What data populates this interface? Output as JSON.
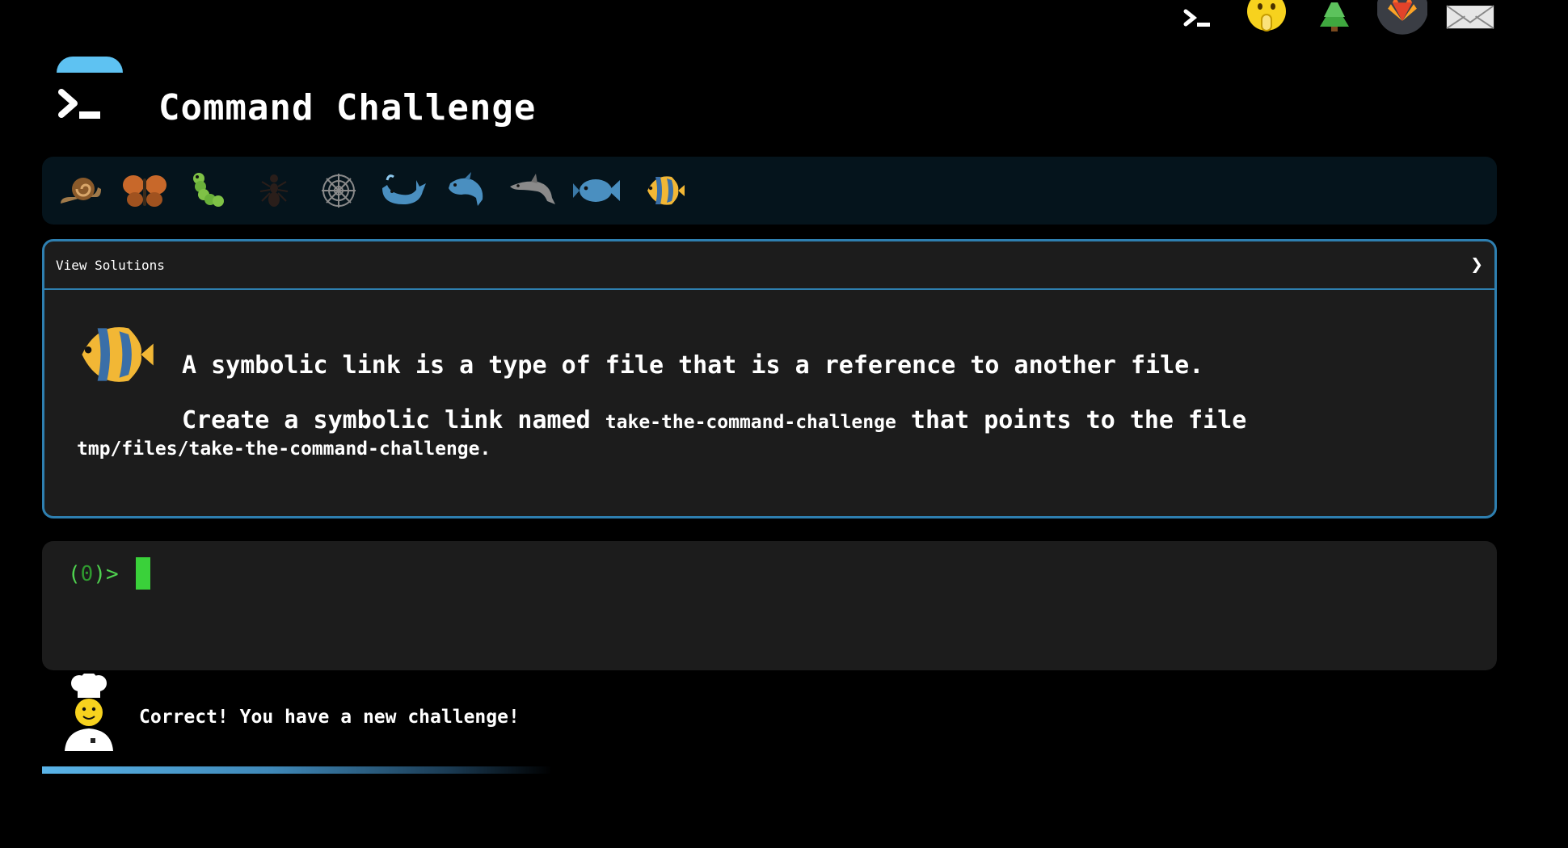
{
  "header": {
    "title": "Command Challenge"
  },
  "top_icons": [
    {
      "name": "terminal-icon",
      "color": "#ffffff"
    },
    {
      "name": "hand-over-mouth-face-icon",
      "color": "#f7d21e"
    },
    {
      "name": "tree-icon",
      "color": "#3fa83f"
    },
    {
      "name": "gitlab-fox-icon",
      "color": "#e2432a"
    },
    {
      "name": "envelope-icon",
      "color": "#ffffff"
    }
  ],
  "progress_emojis": [
    "snail",
    "butterfly",
    "caterpillar",
    "ant",
    "spider-web",
    "whale",
    "shark",
    "dolphin",
    "fish",
    "tropical-fish"
  ],
  "solutions": {
    "label": "View Solutions",
    "chevron": "❯"
  },
  "challenge": {
    "line1": "A symbolic link is a type of file that is a reference to another file.",
    "line2_prefix": "Create a symbolic link named",
    "link_name": "take-the-command-challenge",
    "line2_suffix": "that points to the file",
    "target_path": "tmp/files/take-the-command-challenge."
  },
  "terminal": {
    "prompt_open": "(",
    "prompt_code": "0",
    "prompt_close": ")>"
  },
  "feedback": {
    "message": "Correct! You have a new challenge!"
  },
  "progress": {
    "fraction": 0.59
  },
  "colors": {
    "accent": "#2e7fb0",
    "terminal_green": "#3ad13a",
    "panel_bg": "#1c1c1c"
  }
}
